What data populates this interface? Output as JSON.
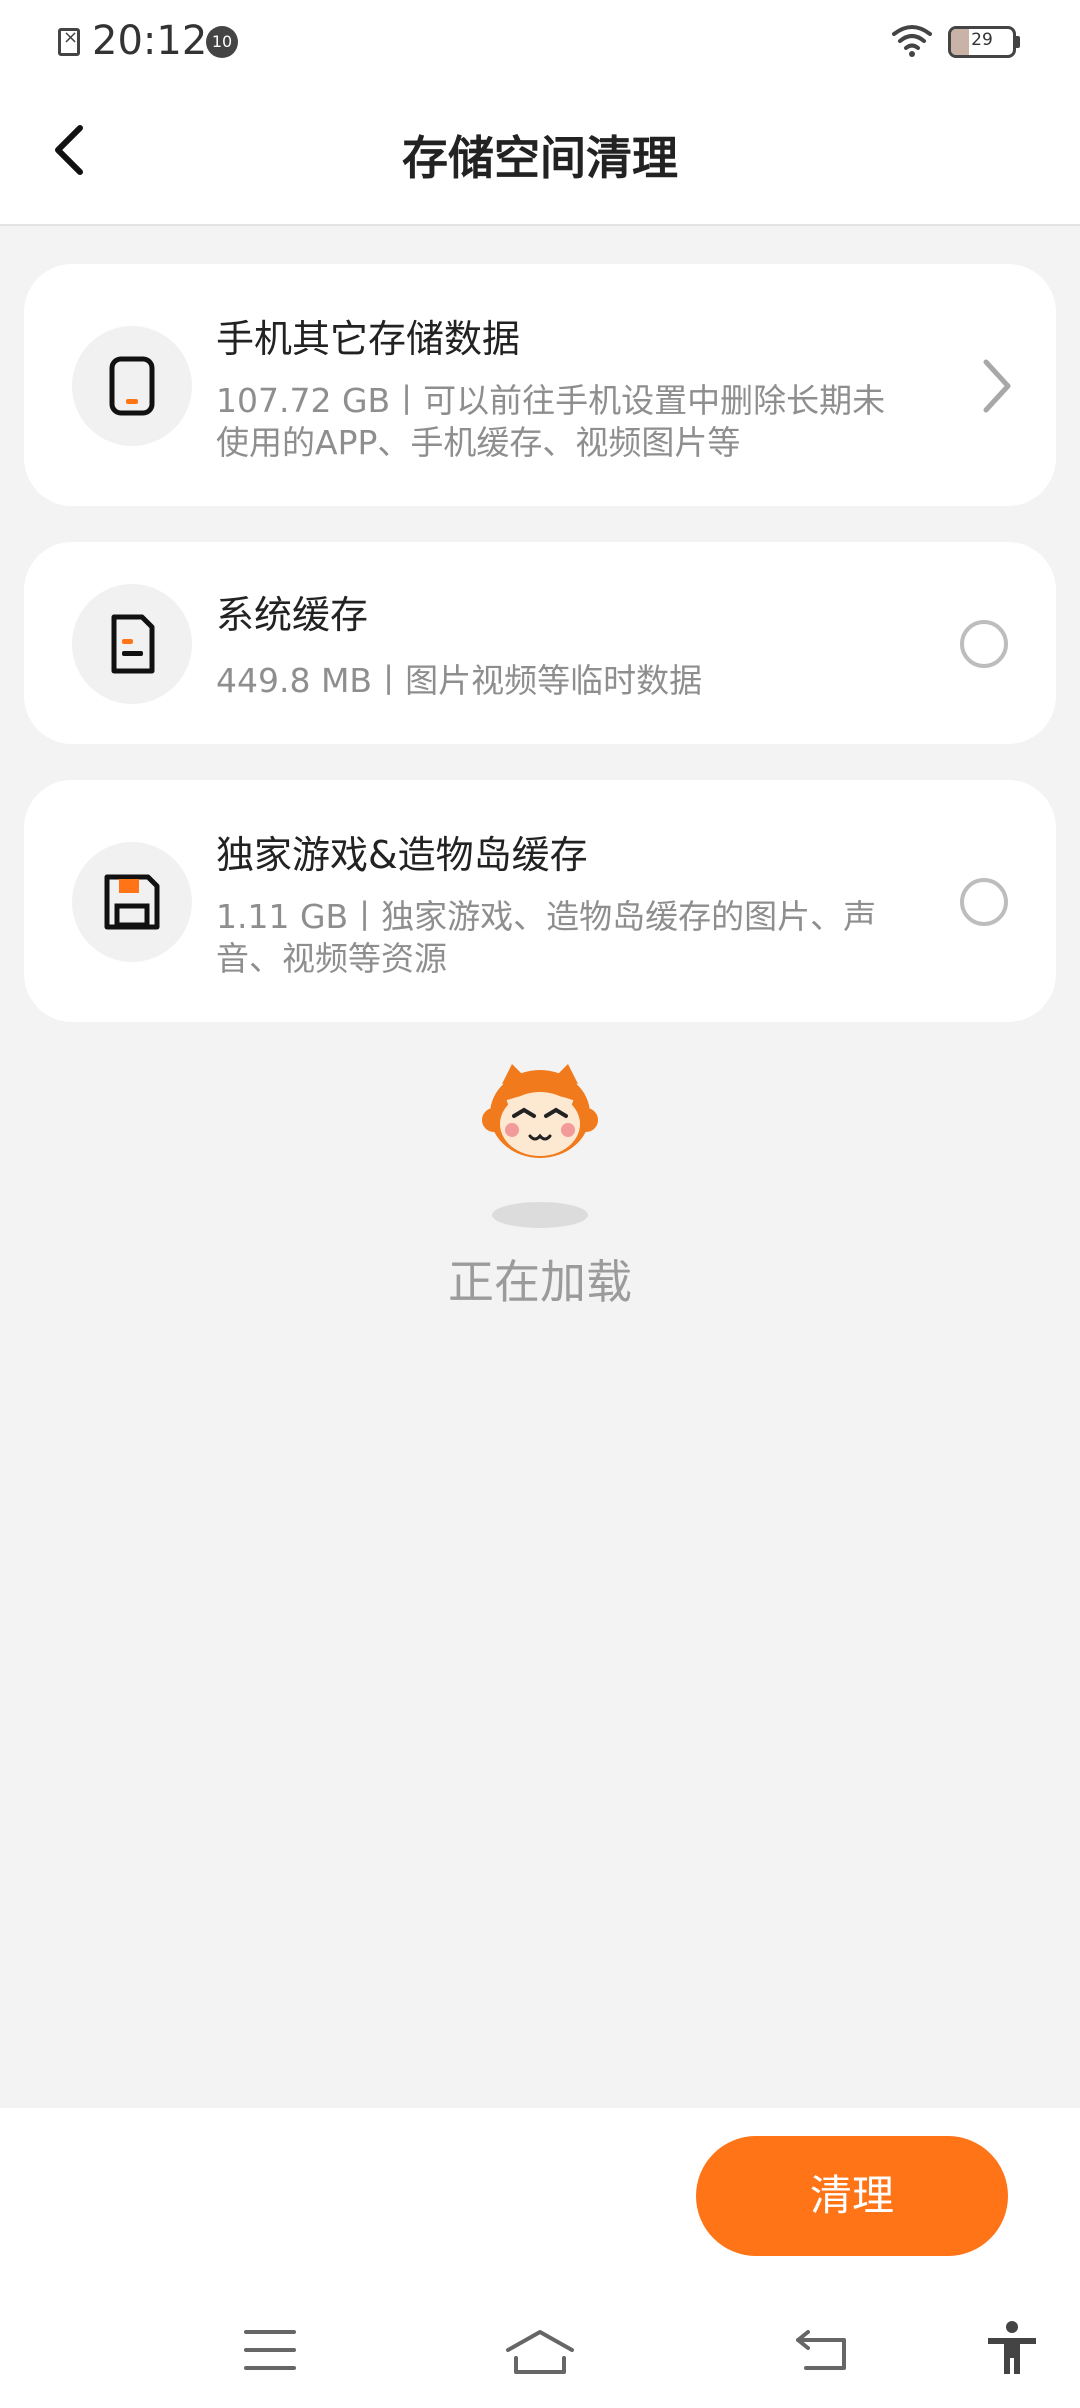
{
  "status_bar": {
    "time": "20:12",
    "notification_count": "10",
    "battery_level": "29"
  },
  "header": {
    "title": "存储空间清理"
  },
  "items": [
    {
      "title": "手机其它存储数据",
      "description": "107.72 GB丨可以前往手机设置中删除长期未使用的APP、手机缓存、视频图片等",
      "icon": "phone-icon",
      "action": "chevron"
    },
    {
      "title": "系统缓存",
      "description": "449.8 MB丨图片视频等临时数据",
      "icon": "document-icon",
      "action": "radio"
    },
    {
      "title": "独家游戏&造物岛缓存",
      "description": "1.11 GB丨独家游戏、造物岛缓存的图片、声音、视频等资源",
      "icon": "save-icon",
      "action": "radio"
    }
  ],
  "loading": {
    "text": "正在加载",
    "icon": "mascot-icon"
  },
  "footer": {
    "clean_label": "清理"
  },
  "nav": {
    "icons": [
      "menu-icon",
      "home-icon",
      "back-icon",
      "accessibility-icon"
    ]
  },
  "colors": {
    "accent": "#ff7417",
    "background": "#f3f3f3",
    "card": "#ffffff",
    "secondary_text": "#8e8e8e"
  }
}
